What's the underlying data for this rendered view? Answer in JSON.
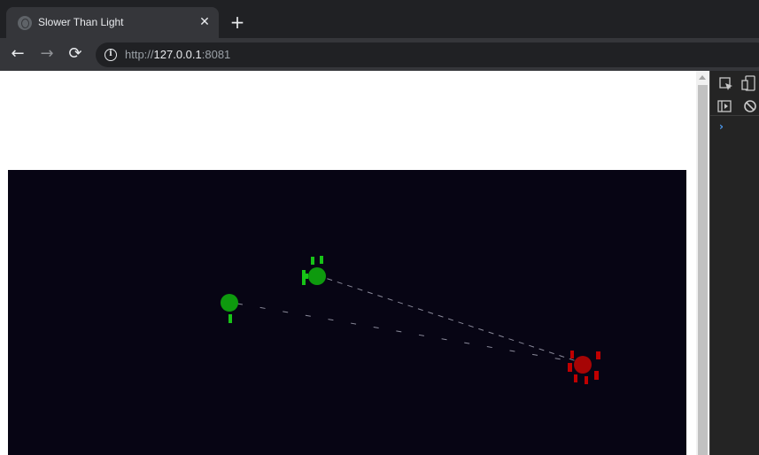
{
  "browser": {
    "tab_title": "Slower Than Light",
    "tab_close_glyph": "✕",
    "new_tab_glyph": "+",
    "url_scheme": "http://",
    "url_host": "127.0.0.1",
    "url_port": ":8081",
    "back_glyph": "←",
    "forward_glyph": "→",
    "reload_glyph": "⟳",
    "info_glyph": "i"
  },
  "devtools": {
    "prompt_glyph": "›",
    "icons": [
      "inspect-element-icon",
      "device-toolbar-icon",
      "show-console-sidebar-icon",
      "clear-console-icon"
    ]
  },
  "game": {
    "colors": {
      "background": "#070514",
      "friendly": "#0e9a0e",
      "friendly_mark": "#17c317",
      "enemy": "#a60505",
      "enemy_mark": "#c00000",
      "route": "#8a8a9a"
    },
    "ships": [
      {
        "id": "friendly-ship-1",
        "faction": "friendly"
      },
      {
        "id": "friendly-ship-2",
        "faction": "friendly"
      },
      {
        "id": "enemy-ship-1",
        "faction": "enemy"
      }
    ]
  }
}
